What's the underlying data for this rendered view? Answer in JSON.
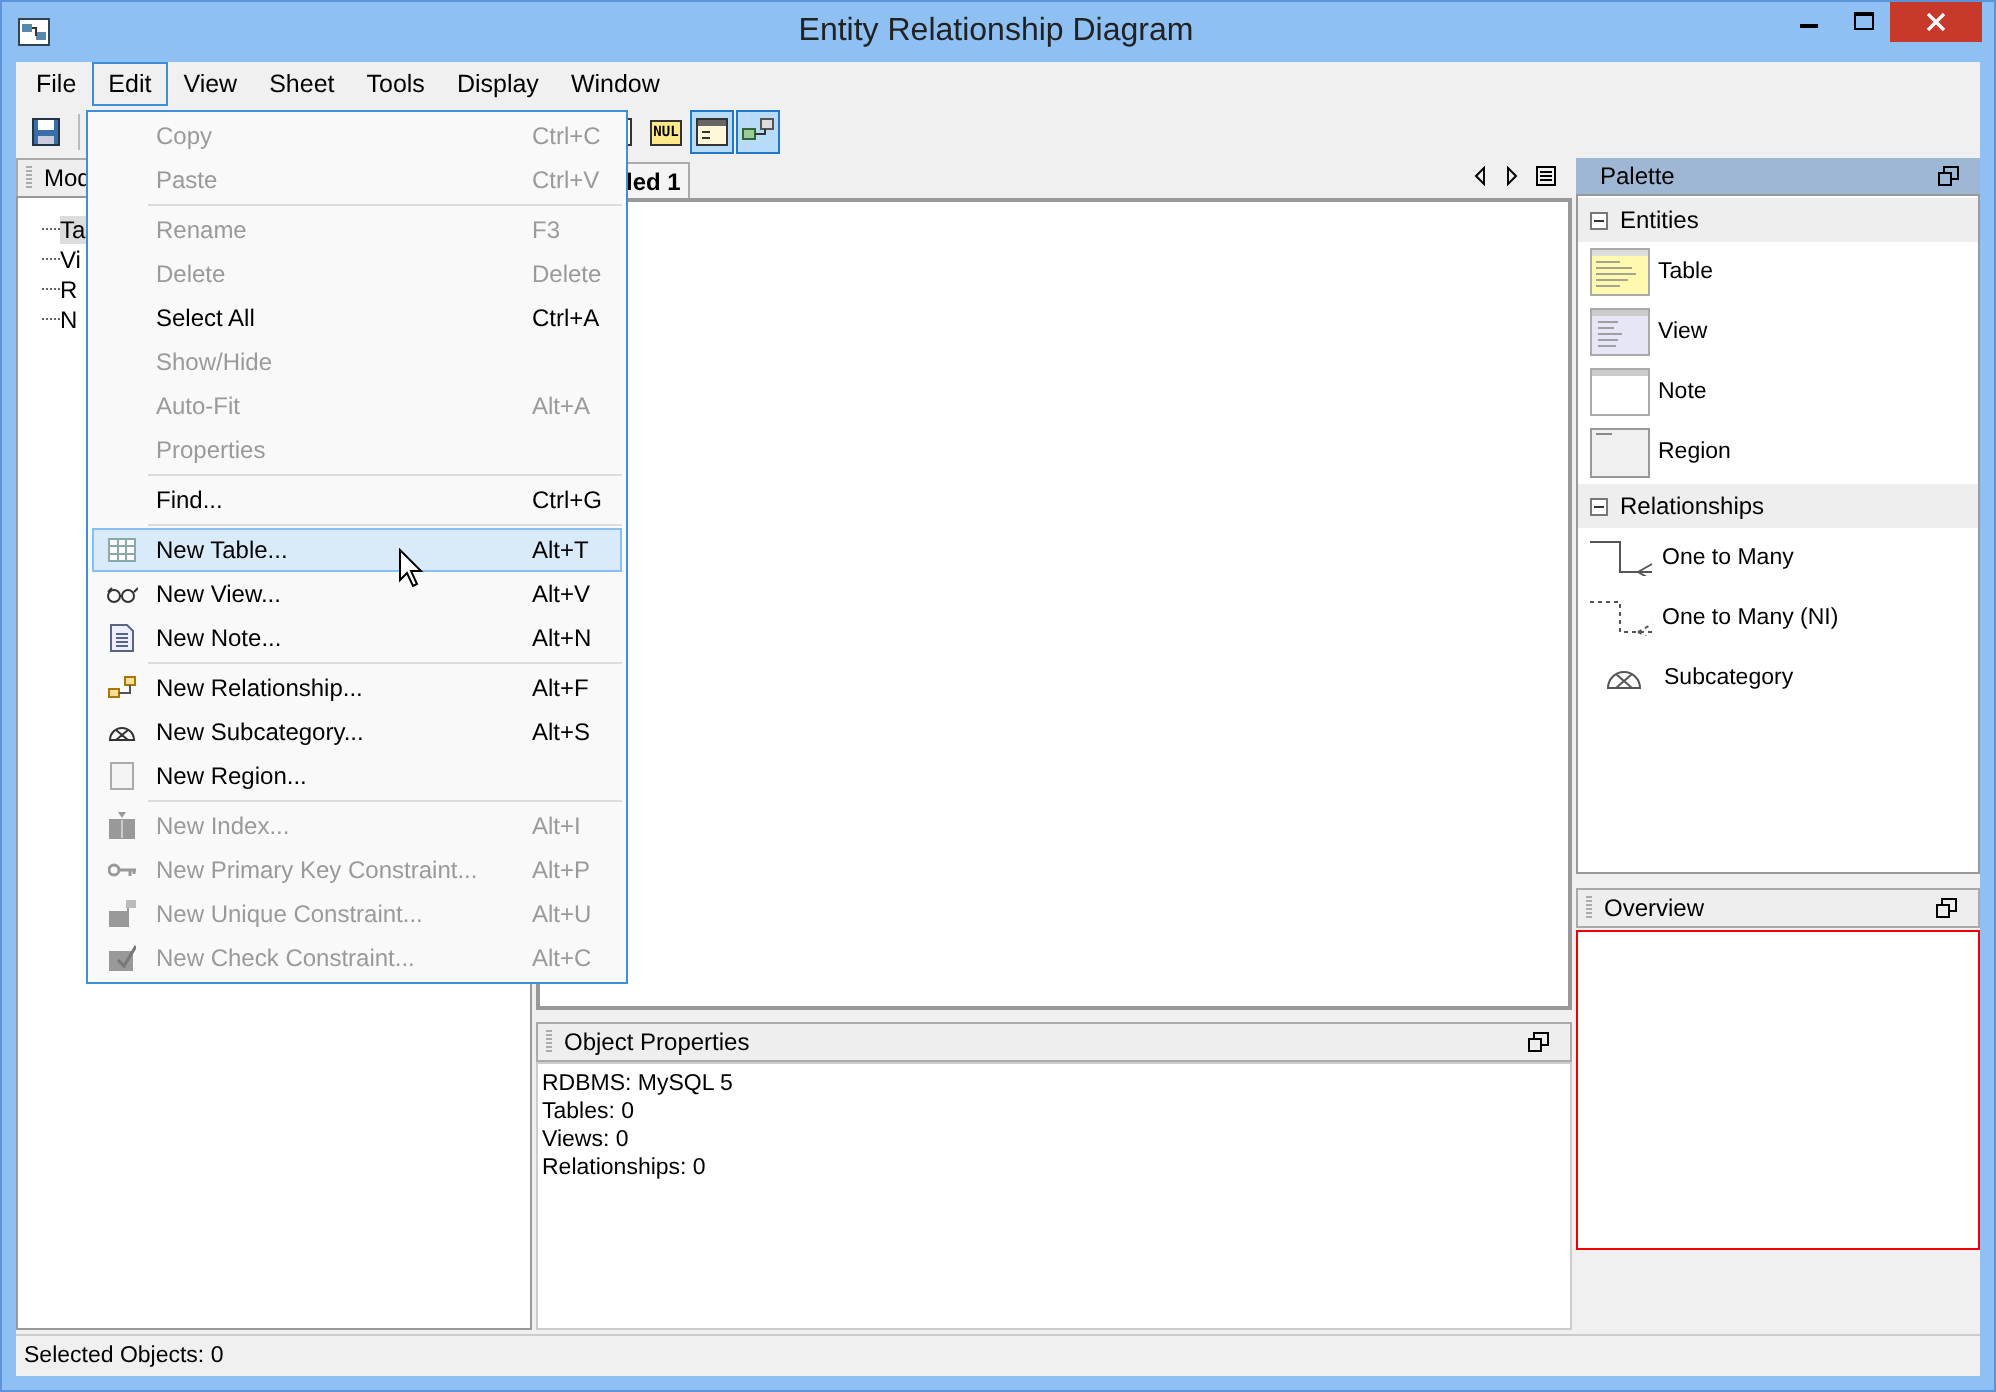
{
  "window": {
    "title": "Entity Relationship Diagram"
  },
  "menubar": [
    {
      "label": "File",
      "selected": false
    },
    {
      "label": "Edit",
      "selected": true
    },
    {
      "label": "View",
      "selected": false
    },
    {
      "label": "Sheet",
      "selected": false
    },
    {
      "label": "Tools",
      "selected": false
    },
    {
      "label": "Display",
      "selected": false
    },
    {
      "label": "Window",
      "selected": false
    }
  ],
  "toolbar": [
    {
      "kind": "save",
      "selected": false
    },
    {
      "kind": "sep"
    },
    {
      "kind": "list",
      "selected": false
    },
    {
      "kind": "null",
      "text": "NUL",
      "selected": false
    },
    {
      "kind": "columns",
      "selected": true
    },
    {
      "kind": "diagram",
      "selected": true
    }
  ],
  "left_panel": {
    "tab": "Mod",
    "tree": [
      {
        "label": "Ta",
        "selected": true
      },
      {
        "label": "Vi",
        "selected": false
      },
      {
        "label": "R",
        "selected": false
      },
      {
        "label": "N",
        "selected": false
      }
    ]
  },
  "editor": {
    "tab": "led 1"
  },
  "edit_menu": [
    {
      "kind": "plain",
      "label": "Copy",
      "shortcut": "Ctrl+C",
      "disabled": true,
      "selected": false
    },
    {
      "kind": "plain",
      "label": "Paste",
      "shortcut": "Ctrl+V",
      "disabled": true,
      "selected": false
    },
    {
      "kind": "separator"
    },
    {
      "kind": "plain",
      "label": "Rename",
      "shortcut": "F3",
      "disabled": true,
      "selected": false
    },
    {
      "kind": "plain",
      "label": "Delete",
      "shortcut": "Delete",
      "disabled": true,
      "selected": false
    },
    {
      "kind": "plain",
      "label": "Select All",
      "shortcut": "Ctrl+A",
      "disabled": false,
      "selected": false
    },
    {
      "kind": "plain",
      "label": "Show/Hide",
      "disabled": true,
      "selected": false
    },
    {
      "kind": "plain",
      "label": "Auto-Fit",
      "shortcut": "Alt+A",
      "disabled": true,
      "selected": false
    },
    {
      "kind": "plain",
      "label": "Properties",
      "disabled": true,
      "selected": false
    },
    {
      "kind": "separator"
    },
    {
      "kind": "plain",
      "label": "Find...",
      "shortcut": "Ctrl+G",
      "disabled": false,
      "selected": false
    },
    {
      "kind": "separator"
    },
    {
      "kind": "table",
      "label": "New Table...",
      "shortcut": "Alt+T",
      "disabled": false,
      "selected": true
    },
    {
      "kind": "view",
      "label": "New View...",
      "shortcut": "Alt+V",
      "disabled": false,
      "selected": false
    },
    {
      "kind": "note",
      "label": "New Note...",
      "shortcut": "Alt+N",
      "disabled": false,
      "selected": false
    },
    {
      "kind": "separator"
    },
    {
      "kind": "relationship",
      "label": "New Relationship...",
      "shortcut": "Alt+F",
      "disabled": false,
      "selected": false
    },
    {
      "kind": "subcategory",
      "label": "New Subcategory...",
      "shortcut": "Alt+S",
      "disabled": false,
      "selected": false
    },
    {
      "kind": "region",
      "label": "New Region...",
      "disabled": false,
      "selected": false
    },
    {
      "kind": "separator"
    },
    {
      "kind": "index",
      "label": "New Index...",
      "shortcut": "Alt+I",
      "disabled": true,
      "selected": false
    },
    {
      "kind": "key",
      "label": "New Primary Key Constraint...",
      "shortcut": "Alt+P",
      "disabled": true,
      "selected": false
    },
    {
      "kind": "unique",
      "label": "New Unique Constraint...",
      "shortcut": "Alt+U",
      "disabled": true,
      "selected": false
    },
    {
      "kind": "check",
      "label": "New Check Constraint...",
      "shortcut": "Alt+C",
      "disabled": true,
      "selected": false
    }
  ],
  "palette": {
    "title": "Palette",
    "sections": [
      {
        "title": "Entities",
        "expanded": true,
        "items": [
          {
            "label": "Table",
            "kind": "table"
          },
          {
            "label": "View",
            "kind": "view"
          },
          {
            "label": "Note",
            "kind": "note"
          },
          {
            "label": "Region",
            "kind": "region"
          }
        ]
      },
      {
        "title": "Relationships",
        "expanded": true,
        "items": [
          {
            "label": "One to Many",
            "kind": "identifying"
          },
          {
            "label": "One to Many (NI)",
            "kind": "nonidentifying"
          },
          {
            "label": "Subcategory",
            "kind": "subcategory"
          }
        ]
      }
    ]
  },
  "properties": {
    "title": "Object Properties",
    "lines": [
      "RDBMS: MySQL 5",
      "Tables: 0",
      "Views: 0",
      "Relationships: 0"
    ]
  },
  "overview": {
    "title": "Overview"
  },
  "status_bar": {
    "text": "Selected Objects: 0"
  }
}
